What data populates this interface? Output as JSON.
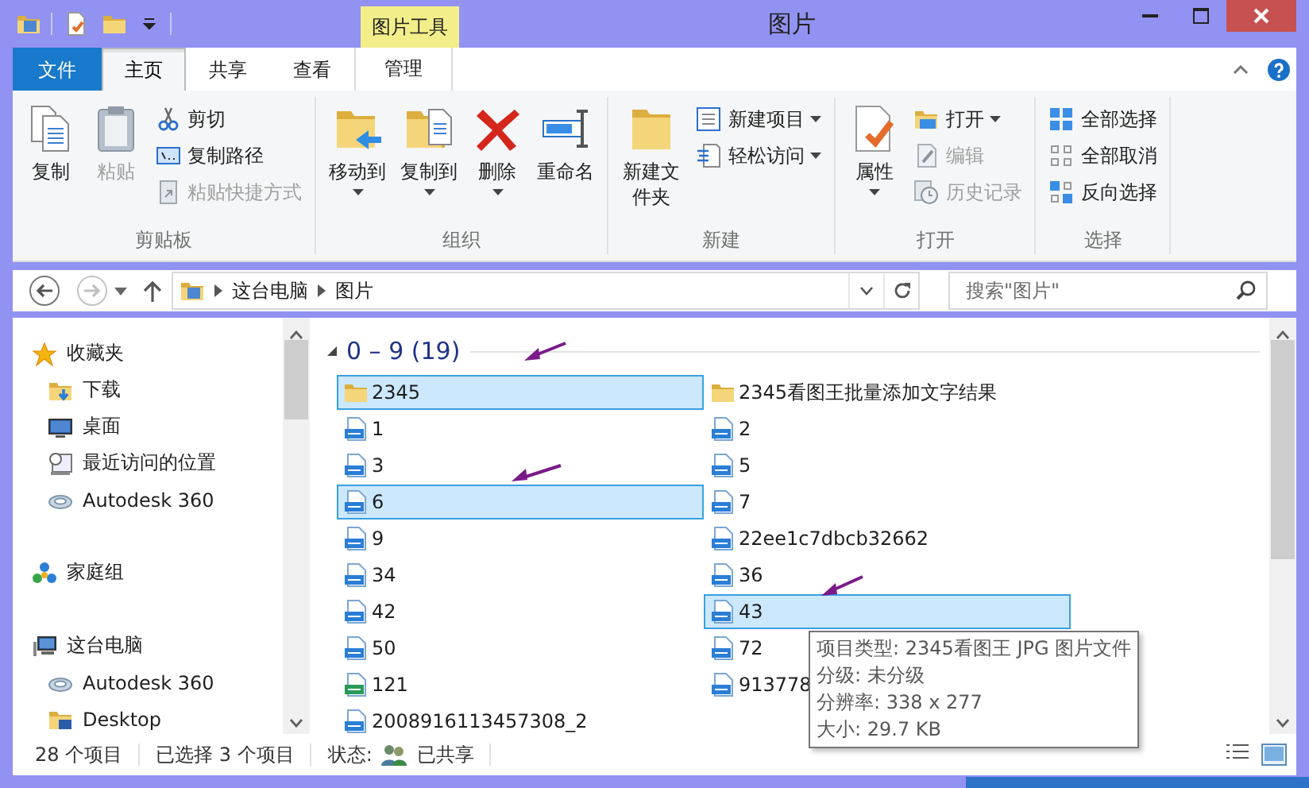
{
  "window": {
    "title": "图片",
    "contextual_group": "图片工具"
  },
  "ribbon_tabs": [
    {
      "label": "文件",
      "kind": "file",
      "selected": false
    },
    {
      "label": "主页",
      "kind": "tab",
      "selected": true
    },
    {
      "label": "共享",
      "kind": "tab",
      "selected": false
    },
    {
      "label": "查看",
      "kind": "tab",
      "selected": false
    },
    {
      "label": "管理",
      "kind": "contextual",
      "selected": false
    }
  ],
  "ribbon_groups": [
    {
      "label": "剪贴板",
      "commands": [
        {
          "label": "复制",
          "kind": "large",
          "dropdown": false,
          "disabled": false
        },
        {
          "label": "粘贴",
          "kind": "large",
          "dropdown": false,
          "disabled": true
        },
        {
          "label": "剪切",
          "kind": "small",
          "dropdown": false,
          "disabled": false
        },
        {
          "label": "复制路径",
          "kind": "small",
          "dropdown": false,
          "disabled": false
        },
        {
          "label": "粘贴快捷方式",
          "kind": "small",
          "dropdown": false,
          "disabled": true
        }
      ]
    },
    {
      "label": "组织",
      "commands": [
        {
          "label": "移动到",
          "kind": "large",
          "dropdown": true,
          "disabled": false
        },
        {
          "label": "复制到",
          "kind": "large",
          "dropdown": true,
          "disabled": false
        },
        {
          "label": "删除",
          "kind": "large",
          "dropdown": true,
          "disabled": false
        },
        {
          "label": "重命名",
          "kind": "large",
          "dropdown": false,
          "disabled": false
        }
      ]
    },
    {
      "label": "新建",
      "commands": [
        {
          "label": "新建文件夹",
          "kind": "large",
          "dropdown": false,
          "disabled": false
        },
        {
          "label": "新建项目",
          "kind": "small",
          "dropdown": true,
          "disabled": false
        },
        {
          "label": "轻松访问",
          "kind": "small",
          "dropdown": true,
          "disabled": false
        }
      ]
    },
    {
      "label": "打开",
      "commands": [
        {
          "label": "属性",
          "kind": "large",
          "dropdown": true,
          "disabled": false
        },
        {
          "label": "打开",
          "kind": "small",
          "dropdown": true,
          "disabled": false
        },
        {
          "label": "编辑",
          "kind": "small",
          "dropdown": false,
          "disabled": true
        },
        {
          "label": "历史记录",
          "kind": "small",
          "dropdown": false,
          "disabled": true
        }
      ]
    },
    {
      "label": "选择",
      "commands": [
        {
          "label": "全部选择",
          "kind": "small",
          "dropdown": false,
          "disabled": false
        },
        {
          "label": "全部取消",
          "kind": "small",
          "dropdown": false,
          "disabled": false
        },
        {
          "label": "反向选择",
          "kind": "small",
          "dropdown": false,
          "disabled": false
        }
      ]
    }
  ],
  "address_bar": {
    "path": [
      "这台电脑",
      "图片"
    ],
    "search_placeholder": "搜索\"图片\""
  },
  "navigation": [
    {
      "label": "收藏夹",
      "children": [
        {
          "label": "下载"
        },
        {
          "label": "桌面"
        },
        {
          "label": "最近访问的位置"
        },
        {
          "label": "Autodesk 360"
        }
      ]
    },
    {
      "label": "家庭组"
    },
    {
      "label": "这台电脑",
      "children": [
        {
          "label": "Autodesk 360"
        },
        {
          "label": "Desktop"
        }
      ]
    }
  ],
  "files": {
    "group": {
      "label": "0 – 9 (19)",
      "expanded": true
    },
    "items": [
      {
        "name": "2345",
        "kind": "folder",
        "selected": true
      },
      {
        "name": "2345看图王批量添加文字结果",
        "kind": "folder",
        "selected": false
      },
      {
        "name": "1",
        "kind": "jpg",
        "selected": false
      },
      {
        "name": "2",
        "kind": "jpg",
        "selected": false
      },
      {
        "name": "3",
        "kind": "jpg",
        "selected": false
      },
      {
        "name": "5",
        "kind": "jpg",
        "selected": false
      },
      {
        "name": "6",
        "kind": "jpg",
        "selected": true
      },
      {
        "name": "7",
        "kind": "jpg",
        "selected": false
      },
      {
        "name": "9",
        "kind": "jpg",
        "selected": false
      },
      {
        "name": "22ee1c7dbcb32662",
        "kind": "jpg",
        "selected": false
      },
      {
        "name": "34",
        "kind": "jpg",
        "selected": false
      },
      {
        "name": "36",
        "kind": "jpg",
        "selected": false
      },
      {
        "name": "42",
        "kind": "jpg",
        "selected": false
      },
      {
        "name": "43",
        "kind": "jpg",
        "selected": true
      },
      {
        "name": "50",
        "kind": "jpg",
        "selected": false
      },
      {
        "name": "72",
        "kind": "jpg",
        "selected": false
      },
      {
        "name": "121",
        "kind": "gif",
        "selected": false
      },
      {
        "name": "913778",
        "kind": "jpg",
        "selected": false
      },
      {
        "name": "2008916113457308_2",
        "kind": "jpg",
        "selected": false
      }
    ]
  },
  "tooltip": [
    "项目类型: 2345看图王 JPG 图片文件",
    "分级: 未分级",
    "分辨率: 338 x 277",
    "大小: 29.7 KB"
  ],
  "status_bar": {
    "item_count": "28 个项目",
    "selection": "已选择 3 个项目",
    "state_label": "状态:",
    "state": "已共享"
  }
}
